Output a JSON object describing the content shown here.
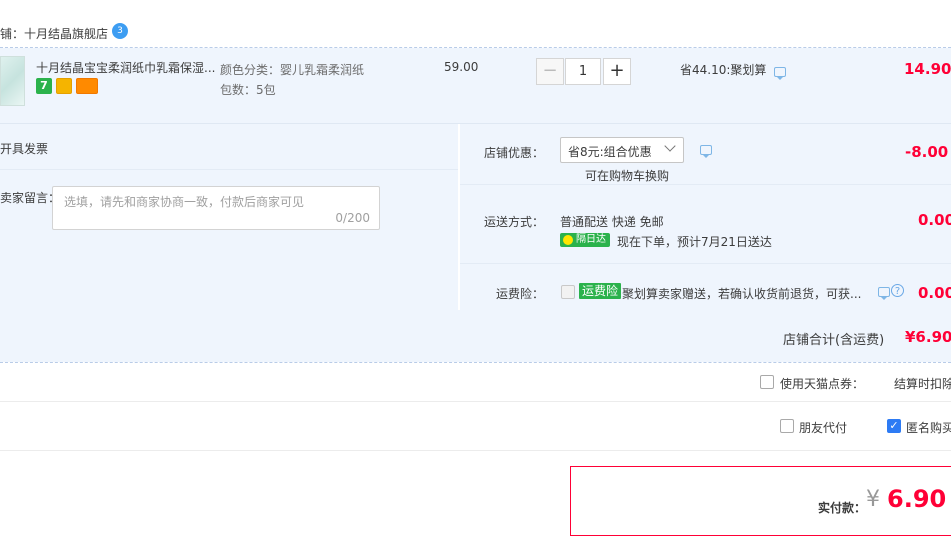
{
  "shop": {
    "label": "铺：十月结晶旗舰店",
    "wangwang_badge": "3"
  },
  "item": {
    "title": "十月结晶宝宝柔润纸巾乳霜保湿...",
    "badge_seven": "7",
    "attr_color": "颜色分类：婴儿乳霜柔润纸",
    "attr_pack": "包数：5包",
    "unit_price": "59.00",
    "quantity": "1",
    "minus_label": "−",
    "plus_label": "+",
    "discount": "省44.10:聚划算",
    "subtotal": "14.90"
  },
  "invoice": {
    "label": "开具发票"
  },
  "message": {
    "label": "卖家留言：",
    "placeholder": "选填，请先和商家协商一致，付款后商家可见",
    "counter": "0/200"
  },
  "shop_discount": {
    "label": "店铺优惠：",
    "selected": "省8元:组合优惠",
    "note": "可在购物车换购",
    "amount": "-8.00"
  },
  "shipping": {
    "label": "运送方式：",
    "method": "普通配送 快递 免邮",
    "next_day_badge": "隔日达",
    "eta": "现在下单，预计7月21日送达",
    "amount": "0.00"
  },
  "insurance": {
    "label": "运费险：",
    "badge": "运费险",
    "text": "聚划算卖家赠送，若确认收货前退货，可获...",
    "amount": "0.00"
  },
  "shop_total": {
    "label": "店铺合计(含运费)",
    "amount": "¥6.90"
  },
  "options": {
    "coupon_label": "使用天猫点券：",
    "coupon_note": "结算时扣除",
    "friend_pay": "朋友代付",
    "anonymous": "匿名购买"
  },
  "payment": {
    "label": "实付款：",
    "currency": "¥",
    "amount": "6.90"
  },
  "colors": {
    "accent_red": "#ff0036",
    "price_red": "#f40",
    "link_blue": "#2d7bf4",
    "panel_blue": "#eff5fd"
  }
}
